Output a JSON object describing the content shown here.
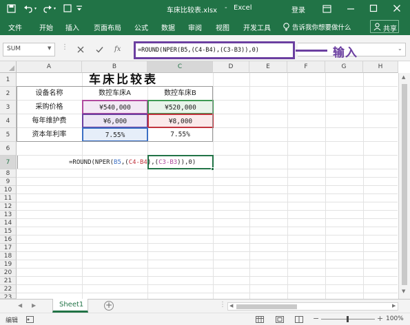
{
  "title_bar": {
    "filename": "车床比较表.xlsx",
    "separator": "-",
    "app": "Excel",
    "login": "登录",
    "icons": [
      "save-icon",
      "undo-icon",
      "redo-icon",
      "quick-access-dropdown-icon",
      "ribbon-display-options-icon",
      "minimize-icon",
      "maximize-icon",
      "close-icon"
    ]
  },
  "ribbon": {
    "tabs": [
      "文件",
      "开始",
      "插入",
      "页面布局",
      "公式",
      "数据",
      "审阅",
      "视图",
      "开发工具"
    ],
    "tell_me": "告诉我你想要做什么",
    "share": "共享"
  },
  "formula_bar": {
    "name_box": "SUM",
    "fx": "fx",
    "formula": "=ROUND(NPER(B5,(C4-B4),(C3-B3)),0)",
    "callout": "输入"
  },
  "columns": [
    "A",
    "B",
    "C",
    "D",
    "E",
    "F",
    "G",
    "H"
  ],
  "rows": [
    "1",
    "2",
    "3",
    "4",
    "5",
    "6",
    "7",
    "8",
    "9",
    "10",
    "11",
    "12",
    "13",
    "14",
    "15",
    "16",
    "17",
    "18",
    "19",
    "20",
    "21",
    "22",
    "23"
  ],
  "sheet": {
    "title": "车床比较表",
    "header_b": "数控车床A",
    "header_c": "数控车床B",
    "labels": [
      "设备名称",
      "采购价格",
      "每年维护费",
      "资本年利率"
    ],
    "b_values": [
      "¥540,000",
      "¥6,000",
      "7.55%"
    ],
    "c_values": [
      "¥520,000",
      "¥8,000",
      "7.55%"
    ],
    "formula_cell": {
      "p1": "=ROUND(NPER(",
      "p2": "B5",
      "p3": ",(",
      "p4": "C4-B4",
      "p5": "),(",
      "p6": "C3-B3",
      "p7": ")),0)"
    },
    "colors": {
      "b3_border": "#b04a9e",
      "b3_fill": "#f3e9f5",
      "c3_border": "#3d9a52",
      "c3_fill": "#e8f4ea",
      "c4_border": "#c0323c",
      "c4_fill": "#fbe9ea",
      "b4_border": "#6b3fa0",
      "b4_fill": "#ece6f5",
      "b5_border": "#3b6fc4",
      "b5_fill": "#e6eef9"
    }
  },
  "tabs": {
    "sheet1": "Sheet1",
    "add": "+"
  },
  "status": {
    "mode": "编辑",
    "zoom": "100%"
  }
}
